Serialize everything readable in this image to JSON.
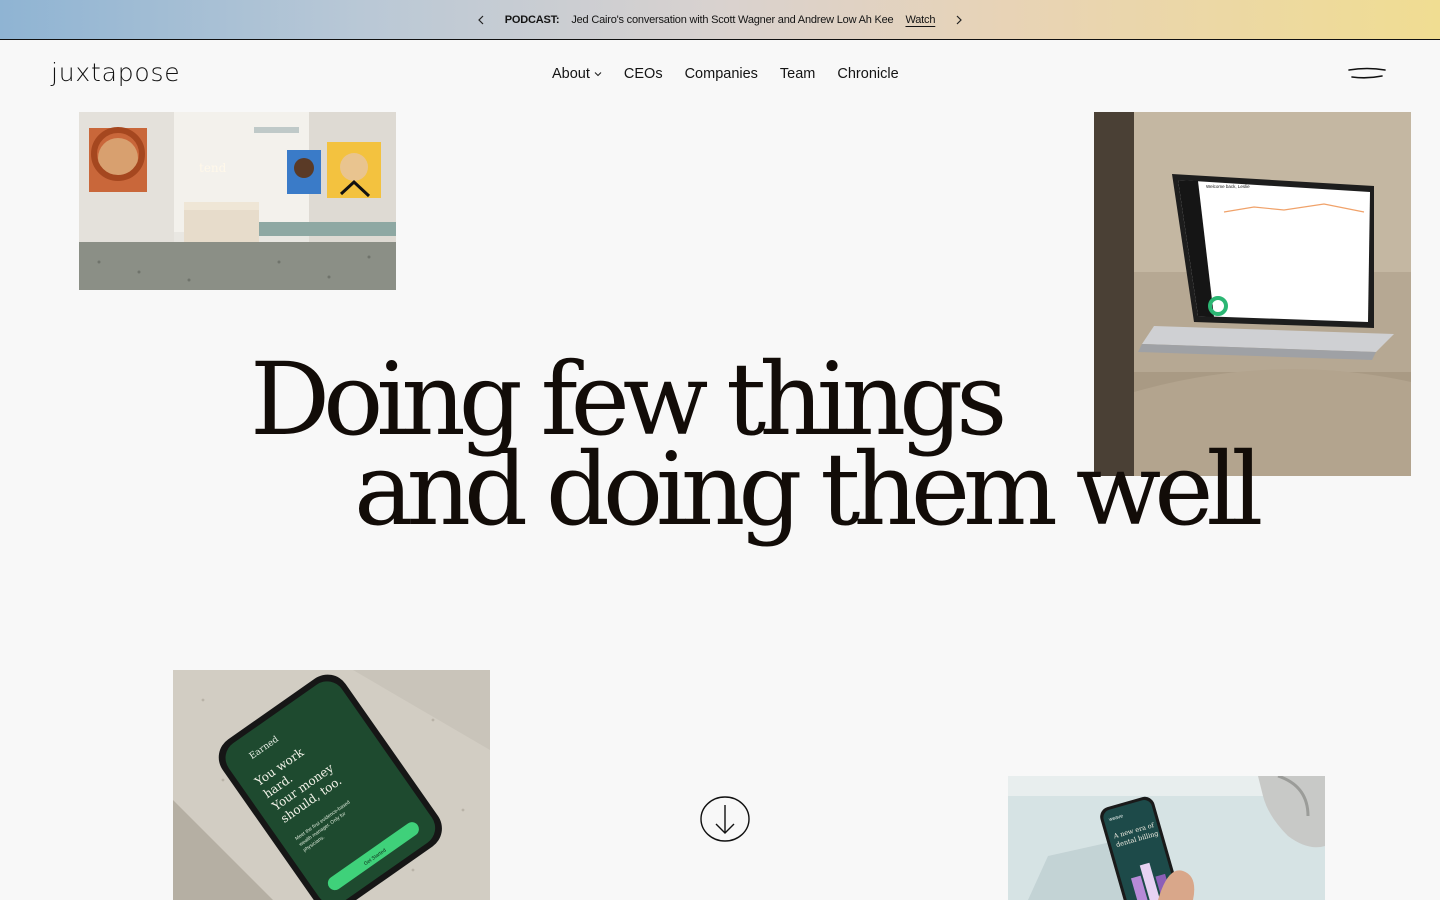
{
  "announcement": {
    "tag": "PODCAST:",
    "message": "Jed Cairo's conversation with Scott Wagner and Andrew Low Ah Kee",
    "link_label": "Watch",
    "prev_icon": "chevron-left-icon",
    "next_icon": "chevron-right-icon"
  },
  "header": {
    "logo": "juxtapose",
    "nav": [
      {
        "label": "About",
        "has_dropdown": true
      },
      {
        "label": "CEOs"
      },
      {
        "label": "Companies"
      },
      {
        "label": "Team"
      },
      {
        "label": "Chronicle"
      }
    ],
    "menu_icon": "hamburger-menu-icon"
  },
  "hero": {
    "line1": "Doing few things",
    "line2": "and doing them well",
    "scroll_icon": "arrow-down-circle-icon"
  },
  "images": {
    "lobby": {
      "sign": "tend"
    },
    "laptop": {
      "greeting": "Welcome back, Leslie"
    },
    "phone": {
      "brand": "Earned",
      "headline": "You work hard. Your money should, too.",
      "body": "Meet the first evidence-based wealth manager. Only for physicians.",
      "cta": "Get Started"
    },
    "hand": {
      "brand": "weave",
      "headline": "A new era of dental billing"
    }
  },
  "colors": {
    "background": "#f8f8f8",
    "text": "#141414",
    "headline": "#120c08"
  }
}
